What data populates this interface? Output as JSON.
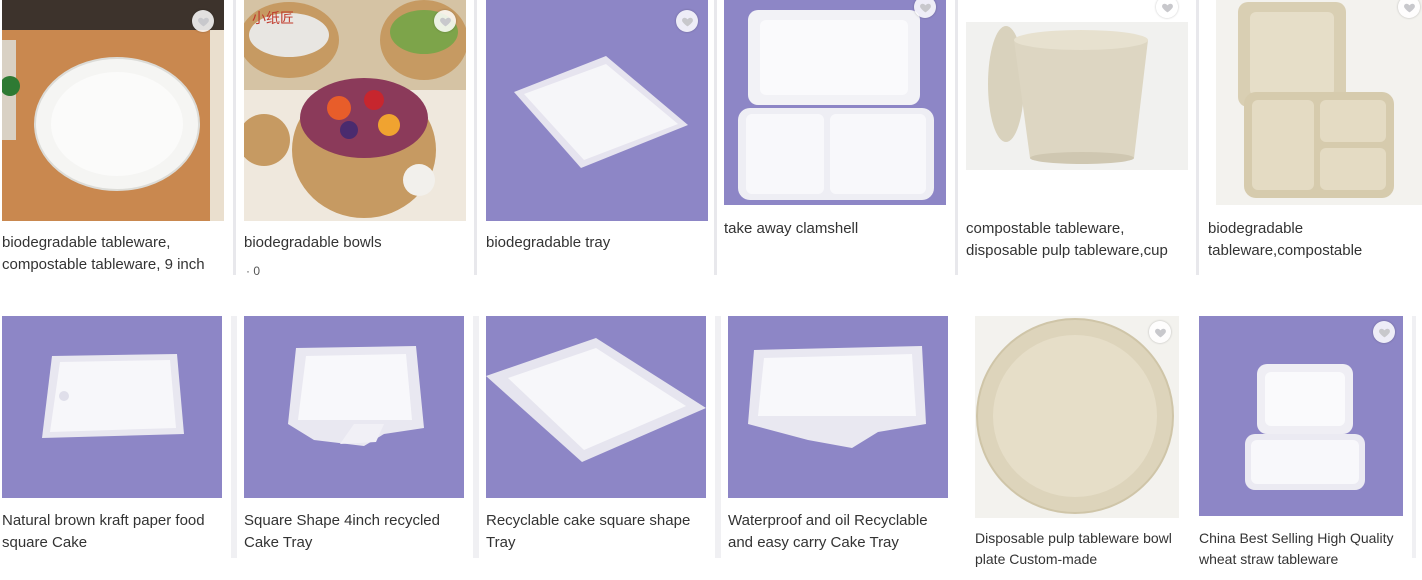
{
  "colors": {
    "lavender": "#8f88c8",
    "heart": "#c8c8cc"
  },
  "products": [
    {
      "name": "biodegradable tableware, compostable tableware, 9 inch"
    },
    {
      "name": "biodegradable bowls"
    },
    {
      "name": "biodegradable tray"
    },
    {
      "name": "take away clamshell"
    },
    {
      "name": "compostable tableware, disposable pulp tableware,cup"
    },
    {
      "name": "biodegradable tableware,compostable"
    },
    {
      "name": "Natural brown kraft paper food square Cake"
    },
    {
      "name": "Square Shape 4inch recycled Cake Tray"
    },
    {
      "name": "Recyclable cake square shape Tray"
    },
    {
      "name": "Waterproof and oil Recyclable and easy carry Cake Tray"
    },
    {
      "name": "Disposable pulp tableware bowl plate Custom-made"
    },
    {
      "name": "China Best Selling High Quality wheat straw tableware"
    }
  ],
  "brand_mark": "小纸匠",
  "favorite_icon": "heart-icon",
  "price_stub": "· 0"
}
